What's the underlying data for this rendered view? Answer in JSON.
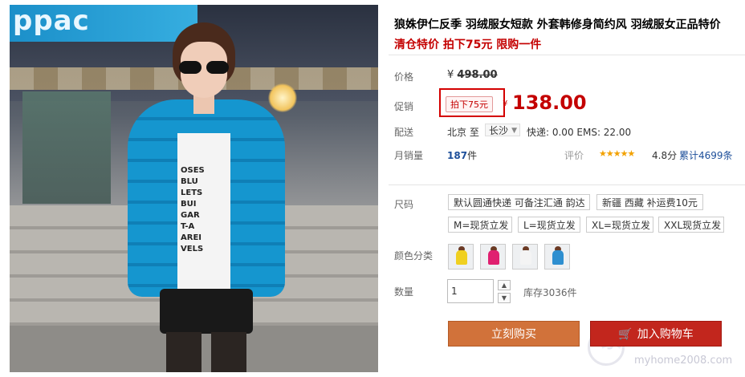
{
  "photo": {
    "shop_sign": "ppac",
    "shirt_print": [
      "OSES",
      "BLU",
      "LETS",
      "BUI",
      "GAR",
      "T-A",
      "AREI",
      "VELS"
    ]
  },
  "product": {
    "title": "狼姝伊仁反季 羽绒服女短款 外套韩修身简约风 羽绒服女正品特价",
    "subtitle": "清仓特价 拍下75元 限购一件"
  },
  "price": {
    "label": "价格",
    "currency": "¥",
    "original": "498.00",
    "promo_label": "促销",
    "promo_tag": "拍下75元",
    "promo_currency": "¥",
    "promo_price": "138.00"
  },
  "shipping": {
    "label": "配送",
    "from": "北京 至",
    "dest": "长沙",
    "fee": "快递: 0.00 EMS: 22.00"
  },
  "sales": {
    "label": "月销量",
    "count": "187",
    "unit": "件",
    "rating_label": "评价",
    "stars": "★★★★★",
    "score": "4.8分",
    "reviews": "累计4699条"
  },
  "size": {
    "label": "尺码",
    "options": [
      "默认圆通快递 可备注汇通 韵达",
      "新疆 西藏 补运费10元",
      "M=现货立发",
      "L=现货立发",
      "XL=现货立发",
      "XXL现货立发"
    ]
  },
  "color": {
    "label": "颜色分类",
    "swatches": [
      "#f0d020",
      "#e02070",
      "#f4f4f4",
      "#2e8fd0"
    ]
  },
  "quantity": {
    "label": "数量",
    "value": "1",
    "up": "▲",
    "down": "▼",
    "stock": "库存3036件"
  },
  "actions": {
    "buy_now": "立刻购买",
    "cart_icon": "🛒",
    "add_to_cart": "加入购物车"
  },
  "watermark": {
    "brand": "家",
    "url": "myhome2008.com"
  }
}
